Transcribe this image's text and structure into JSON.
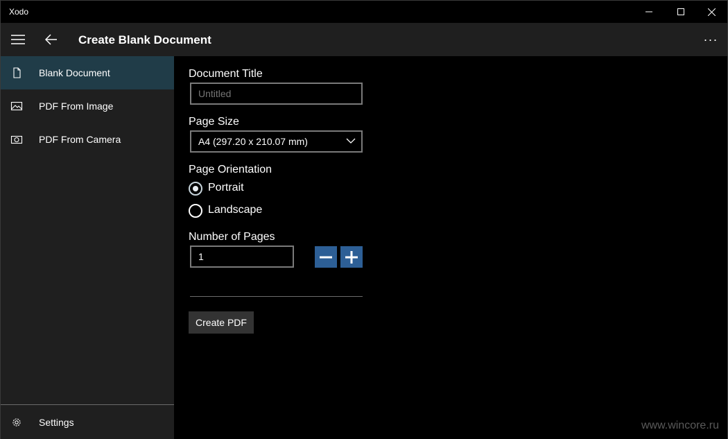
{
  "window": {
    "title": "Xodo"
  },
  "header": {
    "title": "Create Blank Document",
    "more_label": "···"
  },
  "sidebar": {
    "items": [
      {
        "label": "Blank Document",
        "icon": "document-icon",
        "active": true
      },
      {
        "label": "PDF From Image",
        "icon": "image-icon",
        "active": false
      },
      {
        "label": "PDF From Camera",
        "icon": "camera-icon",
        "active": false
      }
    ],
    "settings_label": "Settings"
  },
  "form": {
    "title_label": "Document Title",
    "title_placeholder": "Untitled",
    "page_size_label": "Page Size",
    "page_size_value": "A4 (297.20 x 210.07 mm)",
    "orientation_label": "Page Orientation",
    "orientation_options": [
      "Portrait",
      "Landscape"
    ],
    "orientation_selected": "Portrait",
    "pages_label": "Number of Pages",
    "pages_value": "1",
    "create_label": "Create PDF"
  },
  "watermark": "www.wincore.ru",
  "colors": {
    "accent": "#2d5f96",
    "selected_nav": "#203c48",
    "sidebar_bg": "#1f1f1f"
  }
}
